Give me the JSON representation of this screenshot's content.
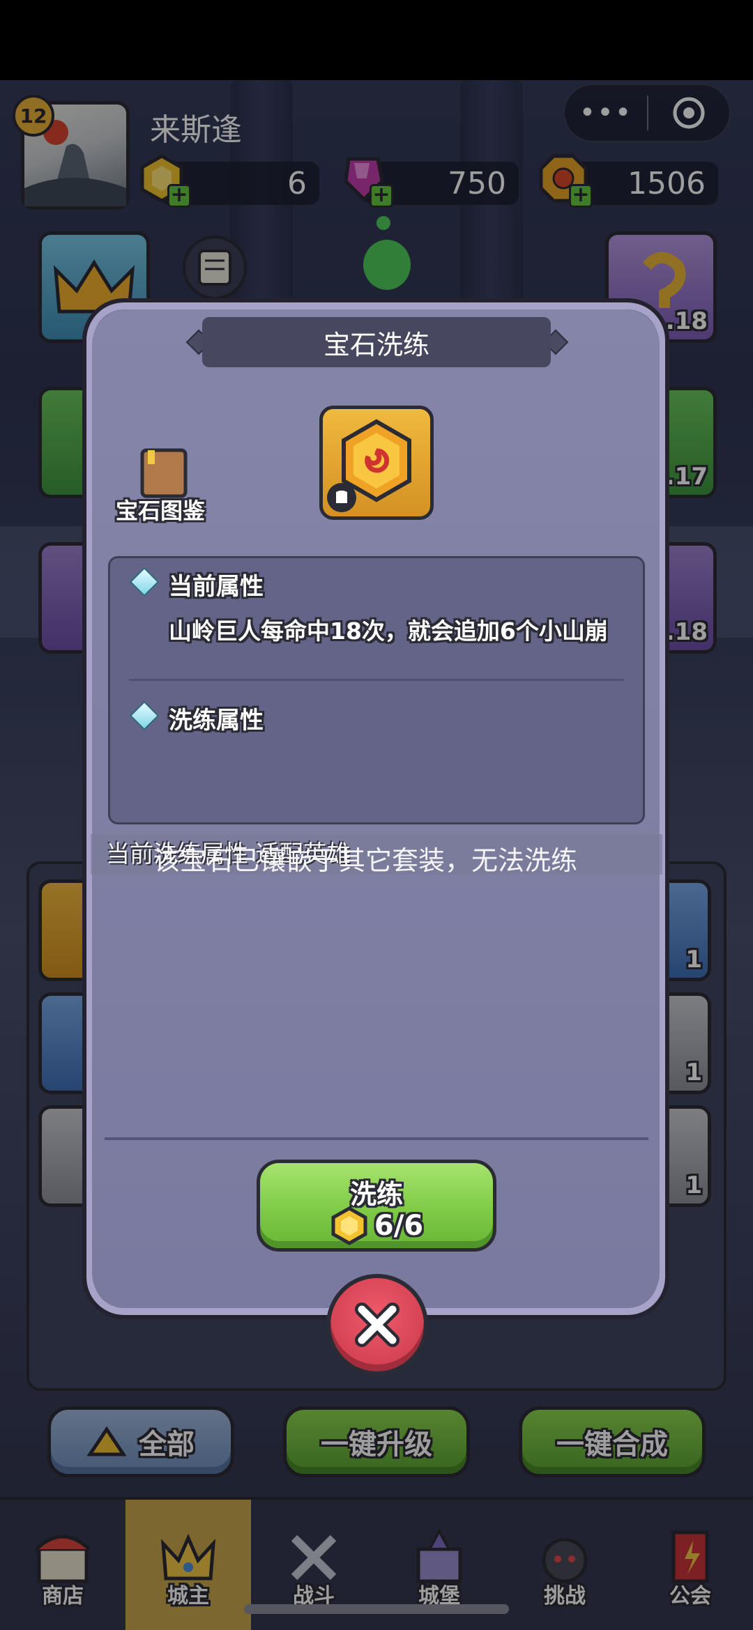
{
  "player": {
    "level": "12",
    "name": "来斯逢"
  },
  "resources": [
    {
      "icon": "yellow-gem-icon",
      "value": "6",
      "color": "#f2c230"
    },
    {
      "icon": "purple-crystal-icon",
      "value": "750",
      "color": "#c23cae"
    },
    {
      "icon": "gold-coin-icon",
      "value": "1506",
      "color": "#e7a32a"
    }
  ],
  "capsule": {
    "more_label": "•••"
  },
  "side_cards": {
    "right_1": ".18",
    "right_2": ".17",
    "right_3": ".18",
    "left_1": "1"
  },
  "inventory_counts": [
    "1",
    "1",
    "1"
  ],
  "bottom_buttons": {
    "all": "全部",
    "upgrade_all": "一键升级",
    "merge_all": "一键合成"
  },
  "tabs": [
    {
      "label": "商店",
      "icon": "shop-icon"
    },
    {
      "label": "城主",
      "icon": "crown-icon"
    },
    {
      "label": "战斗",
      "icon": "crossed-swords-icon"
    },
    {
      "label": "城堡",
      "icon": "castle-icon"
    },
    {
      "label": "挑战",
      "icon": "demon-icon"
    },
    {
      "label": "公会",
      "icon": "guild-banner-icon"
    }
  ],
  "dialog": {
    "title": "宝石洗练",
    "gem_book_label": "宝石图鉴",
    "current_attr_title": "当前属性",
    "current_attr_text": "山岭巨人每命中18次，就会追加6个小山崩",
    "refine_attr_title": "洗练属性",
    "message_ghost": "当前洗练属性 适配英雄",
    "message": "该宝石已镶嵌于其它套装，无法洗练",
    "refine_button": "洗练",
    "refine_cost": "6/6"
  }
}
